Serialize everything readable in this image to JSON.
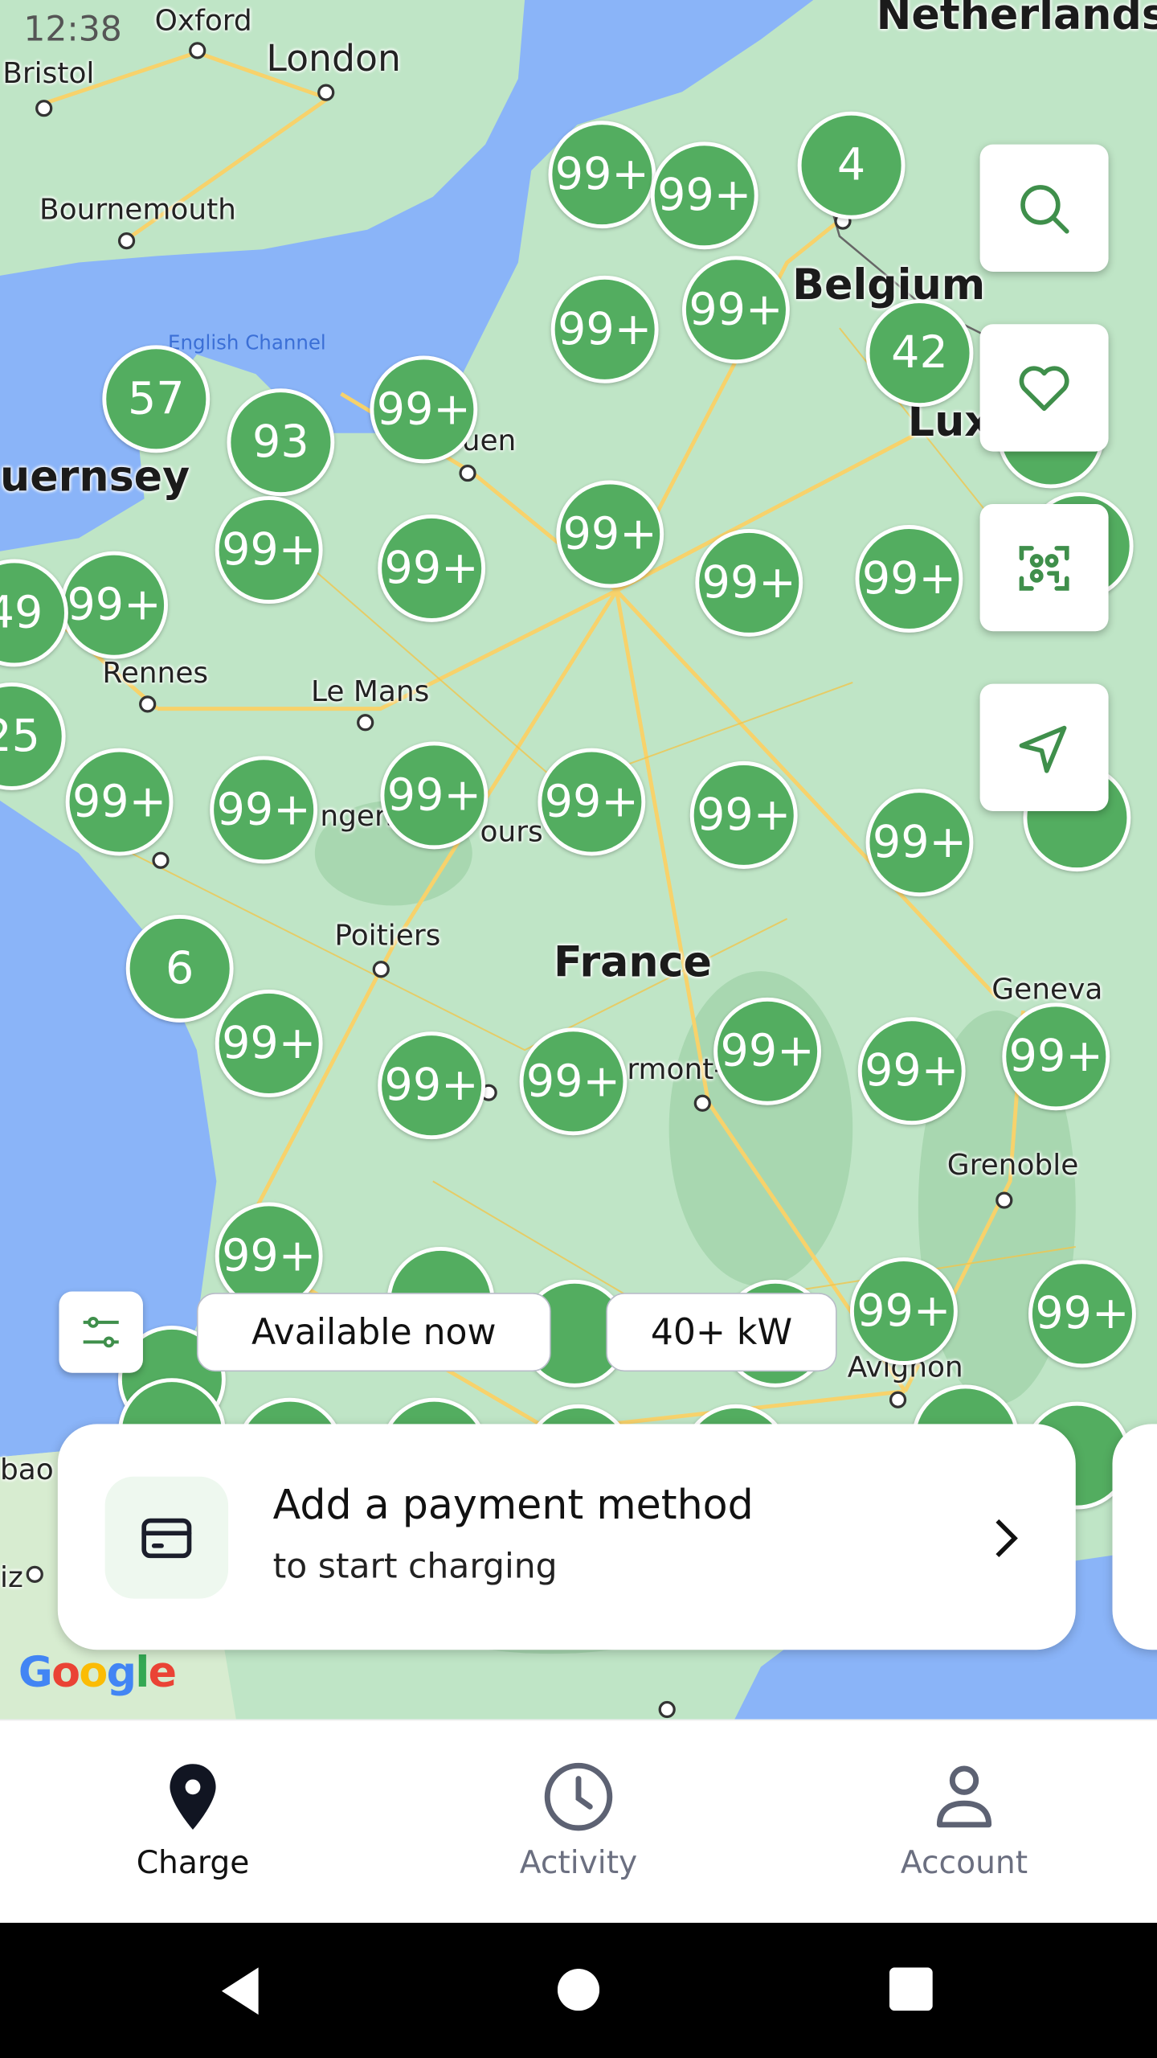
{
  "status_bar": {
    "time": "12:38"
  },
  "map": {
    "places": [
      {
        "name": "Oxford",
        "kind": "city"
      },
      {
        "name": "London",
        "kind": "capital"
      },
      {
        "name": "Bristol",
        "kind": "city"
      },
      {
        "name": "Bournemouth",
        "kind": "city"
      },
      {
        "name": "English Channel",
        "kind": "sea"
      },
      {
        "name": "uernsey",
        "kind": "region"
      },
      {
        "name": "Rennes",
        "kind": "city"
      },
      {
        "name": "Le Mans",
        "kind": "city"
      },
      {
        "name": "Poitiers",
        "kind": "city"
      },
      {
        "name": "France",
        "kind": "country"
      },
      {
        "name": "Geneva",
        "kind": "city"
      },
      {
        "name": "Grenoble",
        "kind": "city"
      },
      {
        "name": "Avignon",
        "kind": "city"
      },
      {
        "name": "Belgium",
        "kind": "country"
      },
      {
        "name": "Netherlands",
        "kind": "country"
      },
      {
        "name": "Lux",
        "kind": "country"
      },
      {
        "name": "uen",
        "kind": "city"
      },
      {
        "name": "ngers",
        "kind": "city"
      },
      {
        "name": "ours",
        "kind": "city"
      },
      {
        "name": "rmont-",
        "kind": "city"
      },
      {
        "name": "bao",
        "kind": "city"
      },
      {
        "name": "iz",
        "kind": "city"
      }
    ],
    "clusters": [
      "99+",
      "99+",
      "4",
      "99+",
      "99+",
      "42",
      "57",
      "93",
      "99+",
      "99+",
      "99+",
      "99+",
      "99+",
      "99+",
      "99+",
      "49",
      "25",
      "99+",
      "99+",
      "99+",
      "99+",
      "99+",
      "99+",
      "6",
      "99+",
      "99+",
      "99+",
      "99+",
      "99+",
      "99+",
      "99+",
      "99+",
      "99+"
    ],
    "attribution": "Google",
    "colors": {
      "water": "#8ab4f8",
      "land": "#bfe5c6",
      "cluster": "#53ad60",
      "road": "#f7d26b"
    }
  },
  "map_controls": {
    "search_icon": "search-icon",
    "favorites_icon": "heart-icon",
    "scan_icon": "qr-scan-icon",
    "locate_icon": "navigation-arrow-icon"
  },
  "filters": {
    "filter_icon": "sliders-icon",
    "chips": [
      {
        "label": "Available now",
        "active": false
      },
      {
        "label": "40+ kW",
        "active": false
      }
    ]
  },
  "payment_card": {
    "title": "Add a payment method",
    "subtitle": "to start charging",
    "icon": "credit-card-icon"
  },
  "bottom_nav": {
    "items": [
      {
        "label": "Charge",
        "icon": "map-pin-icon",
        "active": true
      },
      {
        "label": "Activity",
        "icon": "clock-icon",
        "active": false
      },
      {
        "label": "Account",
        "icon": "user-icon",
        "active": false
      }
    ]
  }
}
